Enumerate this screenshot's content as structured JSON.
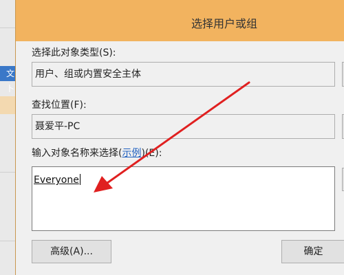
{
  "background": {
    "partial_text": "文 卜"
  },
  "dialog": {
    "title": "选择用户或组",
    "object_type_label": "选择此对象类型(S):",
    "object_type_value": "用户、组或内置安全主体",
    "location_label": "查找位置(F):",
    "location_value": "聂爱平-PC",
    "names_label_prefix": "输入对象名称来选择(",
    "names_label_link": "示例",
    "names_label_suffix": ")(E):",
    "names_value": "Everyone",
    "advanced_button": "高级(A)...",
    "ok_button": "确定"
  },
  "colors": {
    "titlebar": "#f2b35f",
    "dialog_bg": "#f0f0f0",
    "link": "#1e5fbf",
    "annotation_arrow": "#e02020"
  }
}
